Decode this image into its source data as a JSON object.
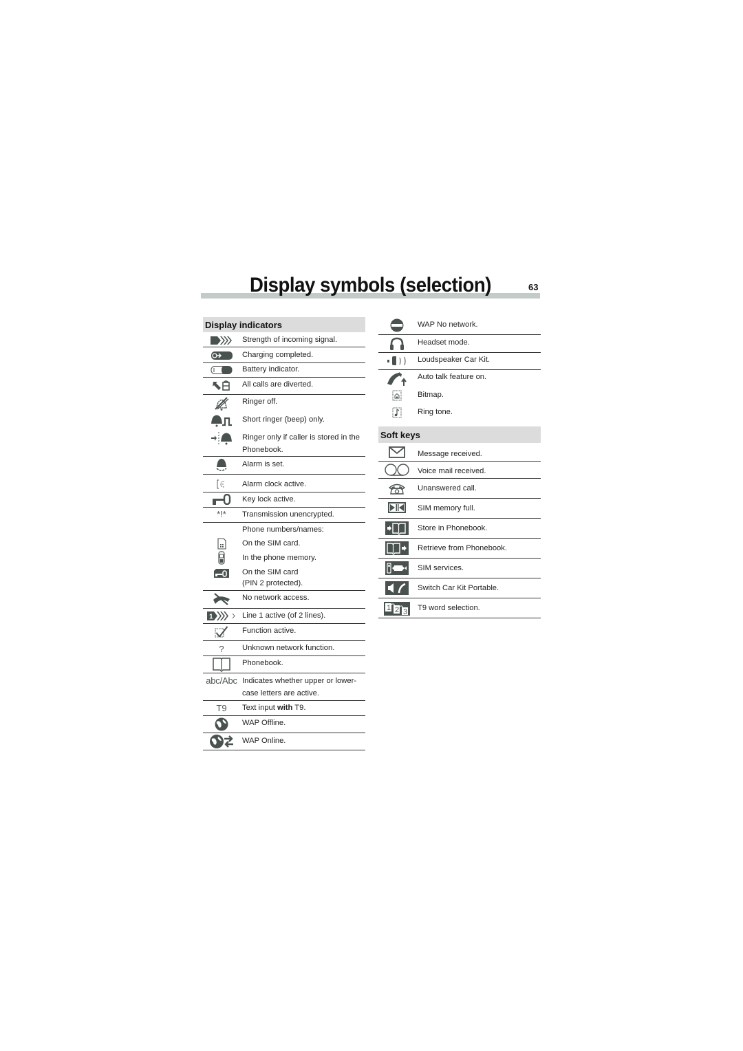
{
  "page": {
    "title": "Display symbols (selection)",
    "number": "63"
  },
  "display_indicators": {
    "heading": "Display indicators",
    "items": [
      {
        "icon": "signal-strength-icon",
        "text": "Strength of incoming signal."
      },
      {
        "icon": "charging-completed-icon",
        "text": "Charging completed."
      },
      {
        "icon": "battery-icon",
        "text": "Battery indicator."
      },
      {
        "icon": "call-divert-icon",
        "text": "All calls are diverted."
      },
      {
        "icon": "ringer-off-icon",
        "text": "Ringer off."
      },
      {
        "icon": "short-ringer-icon",
        "text": "Short ringer (beep) only."
      },
      {
        "icon": "ringer-phonebook-icon",
        "text": "Ringer only if caller is stored in the",
        "text2": "Phonebook."
      },
      {
        "icon": "alarm-bell-icon",
        "text": "Alarm is set."
      },
      {
        "icon": "alarm-clock-icon",
        "text": "Alarm clock active."
      },
      {
        "icon": "key-lock-icon",
        "text": "Key lock active."
      },
      {
        "icon": "unencrypted-icon",
        "glyph": "*!*",
        "text": "Transmission unencrypted."
      },
      {
        "icon": "",
        "text": "Phone numbers/names:"
      },
      {
        "icon": "sim-card-icon",
        "text": "On the SIM card."
      },
      {
        "icon": "phone-memory-icon",
        "text": "In the phone memory."
      },
      {
        "icon": "sim-pin2-icon",
        "text": "On the SIM card",
        "text2": "(PIN 2 protected)."
      },
      {
        "icon": "no-network-icon",
        "text": "No network access."
      },
      {
        "icon": "line1-icon",
        "text": "Line 1 active (of 2 lines)."
      },
      {
        "icon": "function-active-icon",
        "text": "Function active."
      },
      {
        "icon": "unknown-function-icon",
        "glyph": "?",
        "text": "Unknown network function."
      },
      {
        "icon": "phonebook-icon",
        "text": "Phonebook."
      },
      {
        "icon": "case-icon",
        "glyph": "abc/Abc",
        "text": "Indicates whether upper or lower-",
        "text2": "case letters are active."
      },
      {
        "icon": "t9-icon",
        "glyph": "T9",
        "text": "Text input ",
        "text_bold": "with",
        "text_after": " T9."
      },
      {
        "icon": "wap-offline-icon",
        "text": "WAP Offline."
      },
      {
        "icon": "wap-online-icon",
        "text": "WAP Online."
      }
    ]
  },
  "right_indicators": {
    "items": [
      {
        "icon": "wap-no-network-icon",
        "text": "WAP No network."
      },
      {
        "icon": "headset-icon",
        "text": "Headset mode."
      },
      {
        "icon": "loudspeaker-car-kit-icon",
        "text": "Loudspeaker Car Kit."
      },
      {
        "icon": "auto-talk-icon",
        "text": "Auto talk feature on."
      },
      {
        "icon": "bitmap-icon",
        "text": "Bitmap."
      },
      {
        "icon": "ring-tone-icon",
        "text": "Ring tone."
      }
    ]
  },
  "soft_keys": {
    "heading": "Soft keys",
    "items": [
      {
        "icon": "message-icon",
        "text": "Message received."
      },
      {
        "icon": "voicemail-icon",
        "text": "Voice mail received."
      },
      {
        "icon": "unanswered-call-icon",
        "text": "Unanswered call."
      },
      {
        "icon": "sim-memory-full-icon",
        "text": "SIM memory full."
      },
      {
        "icon": "store-phonebook-icon",
        "text": "Store in Phonebook."
      },
      {
        "icon": "retrieve-phonebook-icon",
        "text": "Retrieve from Phonebook."
      },
      {
        "icon": "sim-services-icon",
        "text": "SIM services."
      },
      {
        "icon": "switch-car-kit-icon",
        "text": "Switch Car Kit Portable."
      },
      {
        "icon": "t9-word-selection-icon",
        "text": "T9 word selection."
      }
    ]
  }
}
